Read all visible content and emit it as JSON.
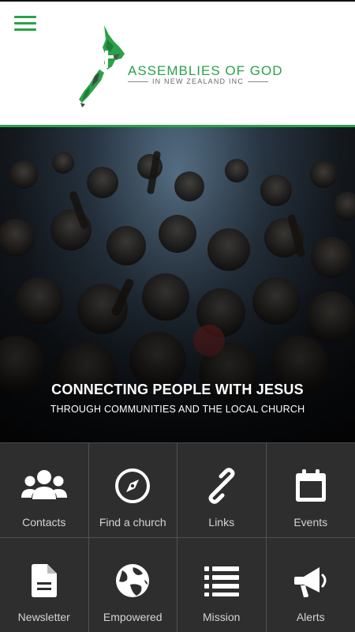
{
  "header": {
    "menu_icon": "hamburger-menu-icon",
    "logo_title": "ASSEMBLIES OF GOD",
    "logo_subtitle": "IN NEW ZEALAND INC",
    "accent_color": "#2aa24a"
  },
  "hero": {
    "title": "CONNECTING PEOPLE WITH JESUS",
    "subtitle": "THROUGH COMMUNITIES AND THE LOCAL CHURCH"
  },
  "tiles": [
    {
      "label": "Contacts",
      "icon": "people-group-icon"
    },
    {
      "label": "Find a church",
      "icon": "compass-icon"
    },
    {
      "label": "Links",
      "icon": "link-icon"
    },
    {
      "label": "Events",
      "icon": "calendar-icon"
    },
    {
      "label": "Newsletter",
      "icon": "document-icon"
    },
    {
      "label": "Empowered",
      "icon": "globe-icon"
    },
    {
      "label": "Mission",
      "icon": "list-icon"
    },
    {
      "label": "Alerts",
      "icon": "megaphone-icon"
    }
  ]
}
